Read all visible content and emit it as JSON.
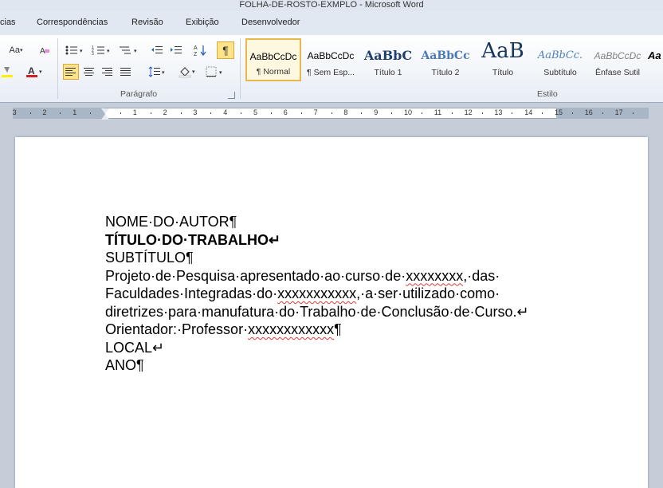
{
  "window": {
    "title": "FOLHA-DE-ROSTO-EXMPLO  -  Microsoft Word"
  },
  "tabs": [
    {
      "label": "cias"
    },
    {
      "label": "Correspondências"
    },
    {
      "label": "Revisão"
    },
    {
      "label": "Exibição"
    },
    {
      "label": "Desenvolvedor"
    }
  ],
  "groups": {
    "paragraph": "Parágrafo",
    "styles": "Estilo"
  },
  "font_group": {
    "change_case": "Aa"
  },
  "styles": [
    {
      "preview": "AaBbCcDc",
      "name": "¶ Normal"
    },
    {
      "preview": "AaBbCcDc",
      "name": "¶ Sem Esp..."
    },
    {
      "preview": "AaBbC",
      "name": "Título 1"
    },
    {
      "preview": "AaBbCc",
      "name": "Título 2"
    },
    {
      "preview": "AaB",
      "name": "Título"
    },
    {
      "preview": "AaBbCc.",
      "name": "Subtítulo"
    },
    {
      "preview": "AaBbCcDc",
      "name": "Ênfase Sutil"
    },
    {
      "preview": "Aa",
      "name": ""
    }
  ],
  "ruler": {
    "labels": [
      "3",
      "2",
      "1",
      "1",
      "2",
      "3",
      "4",
      "5",
      "6",
      "7",
      "8",
      "9",
      "10",
      "11",
      "12",
      "13",
      "14",
      "15",
      "16",
      "17"
    ]
  },
  "document": {
    "l1": "NOME·DO·AUTOR¶",
    "l2": "TÍTULO·DO·TRABALHO↵",
    "l3": "SUBTÍTULO¶",
    "l4a": "Projeto·de·Pesquisa·apresentado·ao·curso·de·",
    "l4b": "xxxxxxxx",
    "l4c": ",·das·",
    "l5a": "Faculdades·Integradas·do·",
    "l5b": "xxxxxxxxxxx",
    "l5c": ",·a·ser·utilizado·como·",
    "l6": "diretrizes·para·manufatura·do·Trabalho·de·Conclusão·de·Curso.↵",
    "l7a": "Orientador:·Professor·",
    "l7b": "xxxxxxxxxxxx",
    "l7c": "¶",
    "l8": "LOCAL↵",
    "l9": "ANO¶"
  }
}
